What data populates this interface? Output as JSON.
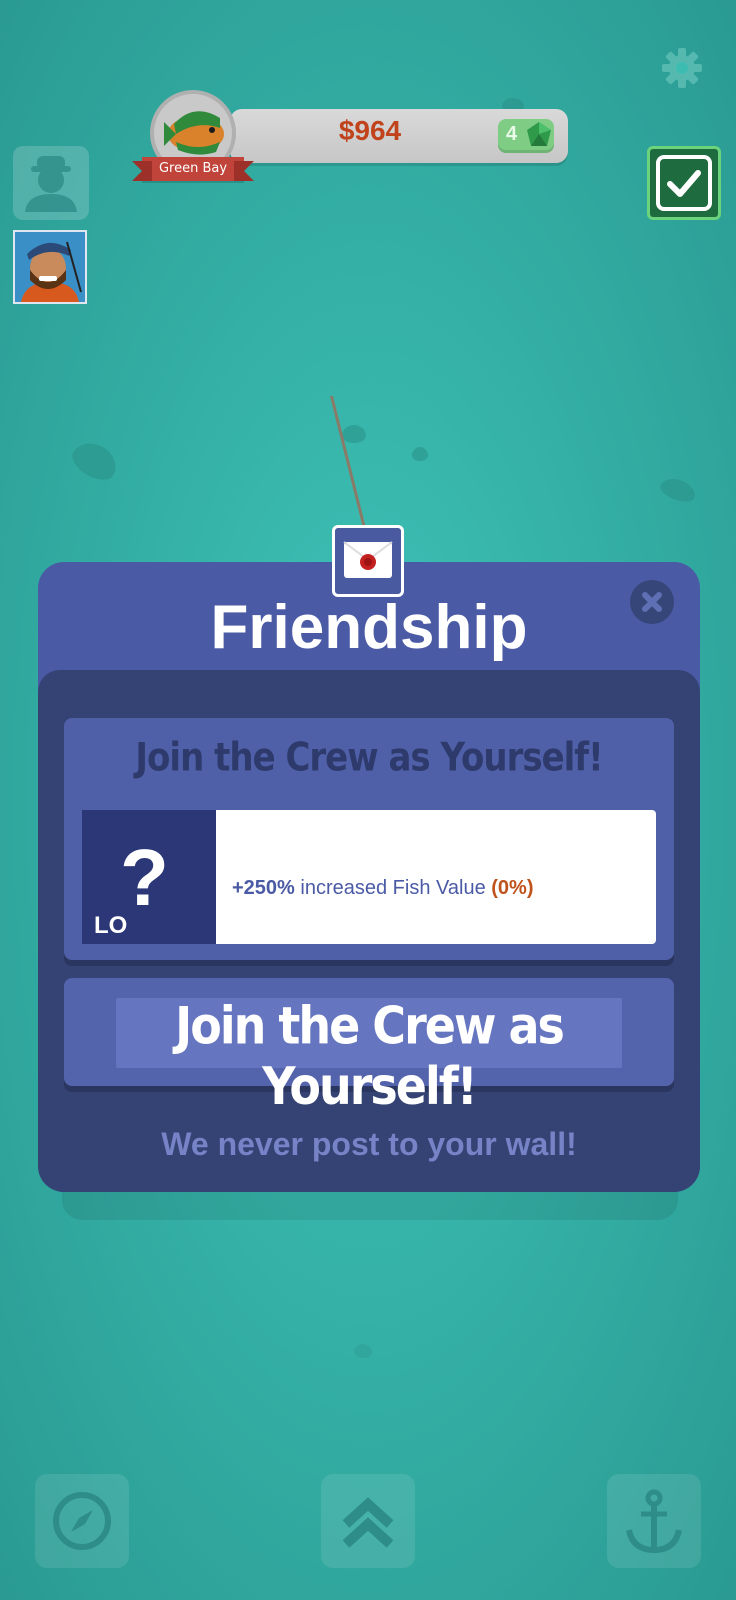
{
  "hud": {
    "money": "$964",
    "gems": "4",
    "location": "Green Bay"
  },
  "dialog": {
    "title": "Friendship",
    "offer_heading": "Join the Crew as Yourself!",
    "offer_badge_symbol": "?",
    "offer_badge_level": "LO",
    "offer_bonus": "+250%",
    "offer_description": "increased Fish Value",
    "offer_current": "(0%)",
    "join_button_label": "Join the Crew as Yourself!",
    "disclaimer": "We never post to your wall!"
  },
  "icons": {
    "settings": "gear-icon",
    "confirm": "check-icon",
    "close": "close-icon",
    "map": "compass-icon",
    "upgrade": "chevron-up-icon",
    "dock": "anchor-icon"
  },
  "colors": {
    "ocean": "#3fc4b9",
    "dialog": "#4b5aa5",
    "dialog_inner": "#344274",
    "money": "#c0431b",
    "banner": "#c0443a"
  }
}
